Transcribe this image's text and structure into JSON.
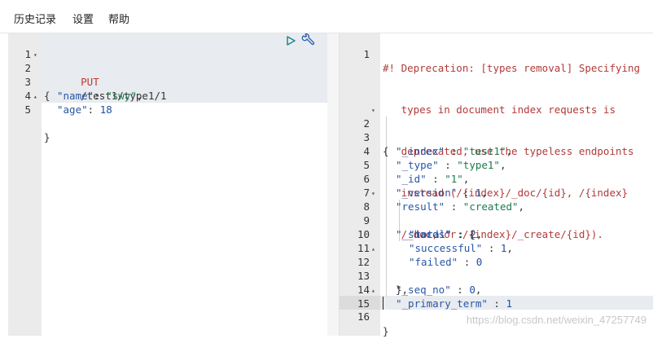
{
  "menu": {
    "history": "历史记录",
    "settings": "设置",
    "help": "帮助"
  },
  "request": {
    "method": "PUT",
    "url": "/test1/type1/1",
    "lines": [
      {
        "n": "1"
      },
      {
        "n": "2",
        "text": "{"
      },
      {
        "n": "3",
        "key": "\"name\"",
        "sep": ": ",
        "val": "\"swy\"",
        "end": ","
      },
      {
        "n": "4",
        "key": "\"age\"",
        "sep": ": ",
        "num": "18"
      },
      {
        "n": "5",
        "text": "}"
      }
    ]
  },
  "response": {
    "warning": [
      "#! Deprecation: [types removal] Specifying",
      "   types in document index requests is",
      "   deprecated, use the typeless endpoints",
      "   instead (/{index}/_doc/{id}, /{index}",
      "   /_doc, or /{index}/_create/{id})."
    ],
    "lines": [
      {
        "n": "2",
        "text": "{"
      },
      {
        "n": "3",
        "key": "\"_index\"",
        "sep": " : ",
        "val": "\"test1\"",
        "end": ","
      },
      {
        "n": "4",
        "key": "\"_type\"",
        "sep": " : ",
        "val": "\"type1\"",
        "end": ","
      },
      {
        "n": "5",
        "key": "\"_id\"",
        "sep": " : ",
        "val": "\"1\"",
        "end": ","
      },
      {
        "n": "6",
        "key": "\"_version\"",
        "sep": " : ",
        "num": "1",
        "end": ","
      },
      {
        "n": "7",
        "key": "\"result\"",
        "sep": " : ",
        "val": "\"created\"",
        "end": ","
      },
      {
        "n": "8",
        "key": "\"_shards\"",
        "sep": " : ",
        "text2": "{"
      },
      {
        "n": "9",
        "key": "\"total\"",
        "sep": " : ",
        "num": "2",
        "end": ","
      },
      {
        "n": "10",
        "key": "\"successful\"",
        "sep": " : ",
        "num": "1",
        "end": ","
      },
      {
        "n": "11",
        "key": "\"failed\"",
        "sep": " : ",
        "num": "0"
      },
      {
        "n": "12",
        "text": "},"
      },
      {
        "n": "13",
        "key": "\"_seq_no\"",
        "sep": " : ",
        "num": "0",
        "end": ","
      },
      {
        "n": "14",
        "key": "\"_primary_term\"",
        "sep": " : ",
        "num": "1"
      },
      {
        "n": "15",
        "text": "}"
      },
      {
        "n": "16"
      }
    ]
  },
  "watermark": "https://blog.csdn.net/weixin_47257749",
  "colors": {
    "method": "#c0392b",
    "key": "#2a56a5",
    "string": "#1e7a4e",
    "number": "#1d4fa3",
    "warning": "#b33a3a"
  },
  "icons": {
    "run": "play-icon",
    "settings": "wrench-icon"
  }
}
